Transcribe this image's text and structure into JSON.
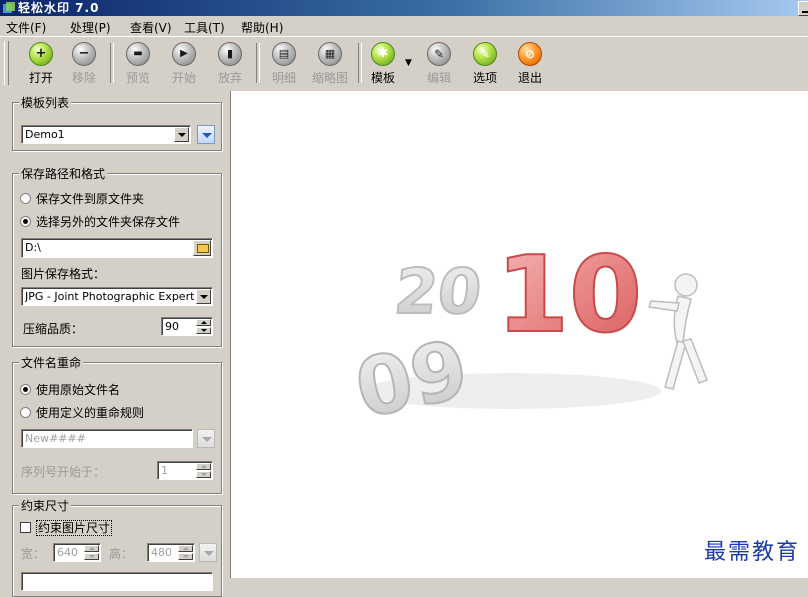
{
  "window": {
    "title": "轻松水印 7.0"
  },
  "menu": [
    "文件(F)",
    "处理(P)",
    "查看(V)",
    "工具(T)",
    "帮助(H)"
  ],
  "toolbar": {
    "open": "打开",
    "remove": "移除",
    "preview": "预览",
    "start": "开始",
    "abort": "放弃",
    "detail": "明细",
    "thumbnail": "缩略图",
    "template": "模板",
    "edit": "编辑",
    "options": "选项",
    "exit": "退出"
  },
  "template_list": {
    "title": "模板列表",
    "selected": "Demo1"
  },
  "save": {
    "title": "保存路径和格式",
    "option_original": "保存文件到原文件夹",
    "option_other": "选择另外的文件夹保存文件",
    "path": "D:\\",
    "format_label": "图片保存格式：",
    "format_value": "JPG - Joint Photographic Experts Group",
    "quality_label": "压缩品质：",
    "quality_value": "90"
  },
  "rename": {
    "title": "文件名重命",
    "option_original": "使用原始文件名",
    "option_custom": "使用定义的重命规则",
    "pattern": "New####",
    "start_label": "序列号开始于：",
    "start_value": "1"
  },
  "size": {
    "title": "约束尺寸",
    "checkbox_label": "约束图片尺寸",
    "width_label": "宽：",
    "width_value": "640",
    "height_label": "高：",
    "height_value": "480"
  },
  "preview": {
    "graphic_top": "20",
    "graphic_red": "10",
    "graphic_bottom": "09",
    "watermark": "最需教育"
  },
  "colors": {
    "title_dark": "#0a246a",
    "title_light": "#a6caf0",
    "face": "#d4d0c8",
    "watermark": "#1a3ba8",
    "accent_red": "#e84a4a"
  }
}
